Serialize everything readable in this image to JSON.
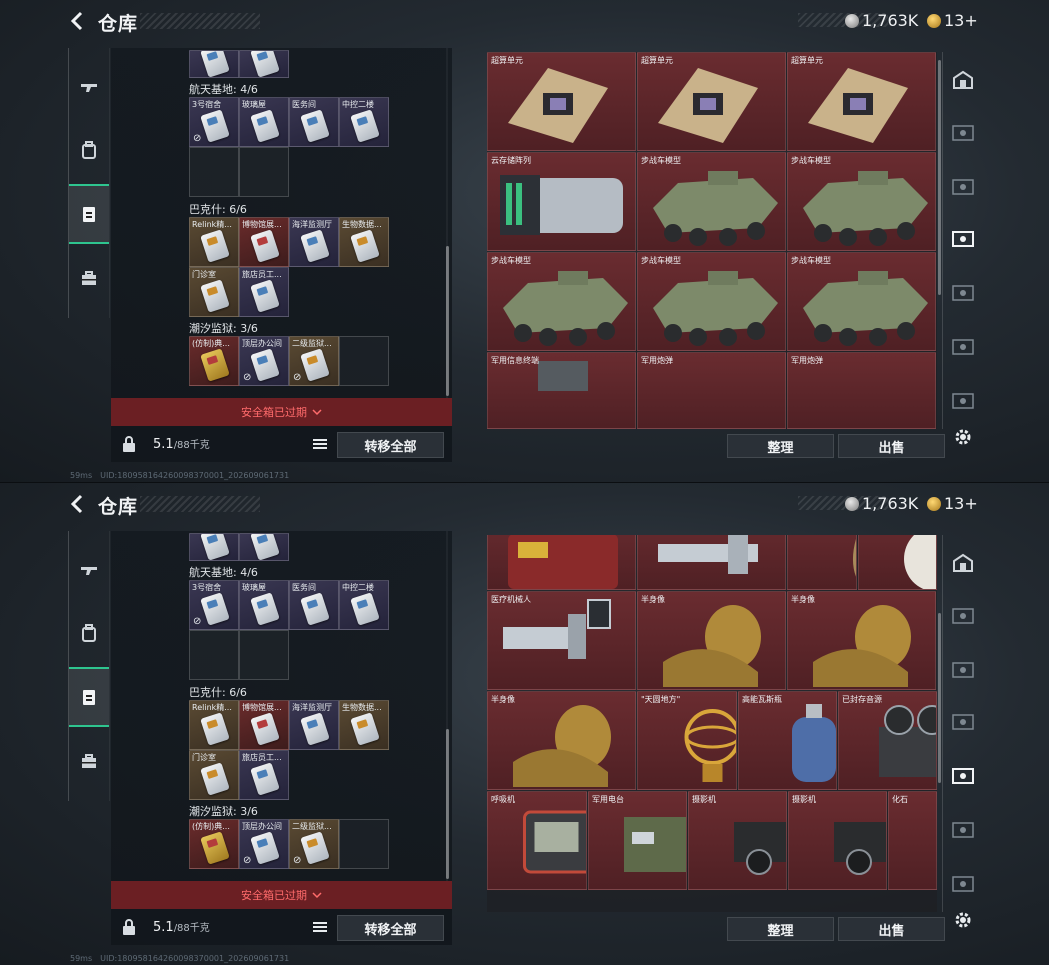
{
  "header": {
    "title": "仓库",
    "silver_value": "1,763K",
    "gold_value": "13+"
  },
  "side_tabs": [
    "gun-icon",
    "backpack-icon",
    "safe-box-icon",
    "briefcase-icon"
  ],
  "keycards": {
    "top_partial": [
      "",
      ""
    ],
    "aerospace_label": "航天基地: 4/6",
    "aerospace": [
      "3号宿舍",
      "玻璃屋",
      "医务间",
      "中控二楼"
    ],
    "bakr_label": "巴克什: 6/6",
    "bakr": [
      "Relink精...",
      "博物馆展...",
      "海洋监测厅",
      "生物数据...",
      "门诊室",
      "旅店员工..."
    ],
    "tide_label": "潮汐监狱: 3/6",
    "tide": [
      "(仿制)典...",
      "顶层办公间",
      "二级监狱..."
    ]
  },
  "expire_text": "安全箱已过期",
  "weight": {
    "current": "5.1",
    "capacity": "/88千克"
  },
  "transfer_all": "转移全部",
  "sort_label": "整理",
  "sell_label": "出售",
  "screen1_items": [
    [
      "超算单元",
      "超算单元",
      "超算单元"
    ],
    [
      "云存储阵列",
      "步战车模型",
      "步战车模型"
    ],
    [
      "步战车模型",
      "步战车模型",
      "步战车模型"
    ],
    [
      "军用信息终端",
      "军用炮弹",
      "军用炮弹"
    ]
  ],
  "screen2_items": [
    [
      "",
      "",
      "",
      ""
    ],
    [
      "医疗机械人",
      "半身像",
      "半身像"
    ],
    [
      "半身像",
      "\"天圆地方\"",
      "高能瓦斯瓶",
      "已封存音源"
    ],
    [
      "呼吸机",
      "军用电台",
      "摄影机",
      "摄影机",
      "化石"
    ]
  ],
  "status_bar": {
    "fps": "59ms",
    "uid": "UID:180958164260098370001_202609061731"
  },
  "colors": {
    "accent_green": "#2ec58f",
    "expired_red": "#ff6b6b",
    "item_bg_red": "#6a2c30"
  }
}
